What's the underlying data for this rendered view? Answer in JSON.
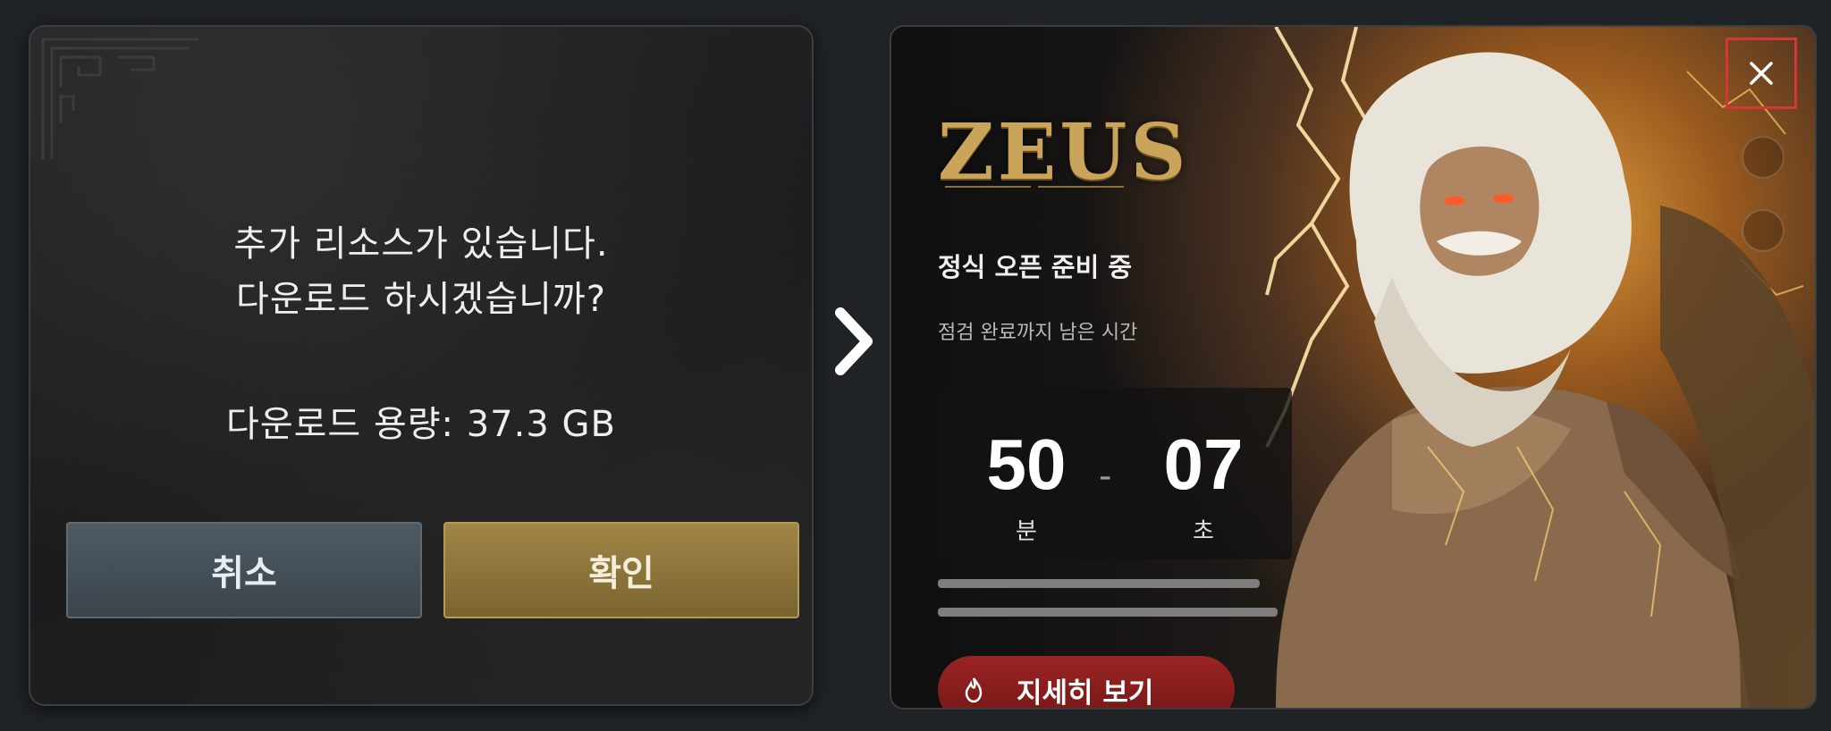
{
  "dialog": {
    "message_line1": "추가 리소스가 있습니다.",
    "message_line2": "다운로드 하시겠습니까?",
    "download_size": "다운로드 용량: 37.3 GB",
    "cancel_label": "취소",
    "confirm_label": "확인"
  },
  "arrow_icon": "chevron-right-icon",
  "promo": {
    "logo": "ZEUS",
    "title": "정식 오픈 준비 중",
    "subtitle": "점검 완료까지 남은 시간",
    "timer": {
      "minutes": "50",
      "minutes_unit": "분",
      "separator": "-",
      "seconds": "07",
      "seconds_unit": "초"
    },
    "details_label": "지세히 보기",
    "close_icon": "close-icon"
  },
  "colors": {
    "background": "#1f2326",
    "cancel_button": "#4f5a63",
    "confirm_button": "#a08646",
    "details_button": "#9a2424",
    "close_highlight": "#d23838"
  }
}
